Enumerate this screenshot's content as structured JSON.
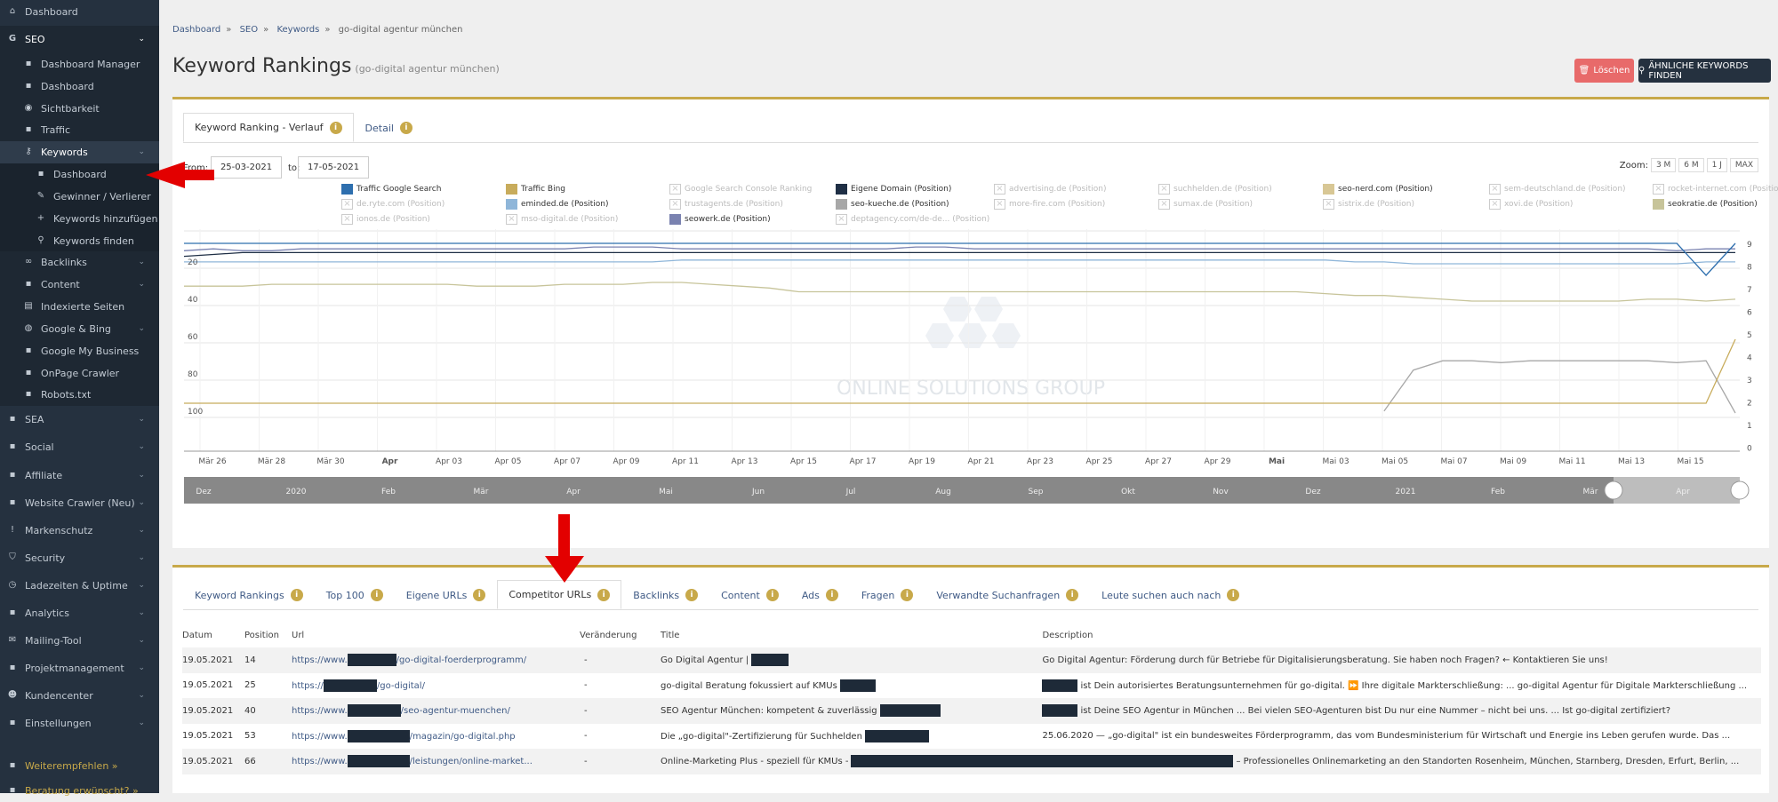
{
  "sidebar": {
    "items": [
      {
        "label": "Dashboard",
        "icon": "home-icon"
      },
      {
        "label": "SEO",
        "icon": "google-g-icon"
      },
      {
        "label": "Dashboard Manager",
        "icon": "dashboard-gauge-icon"
      },
      {
        "label": "Dashboard",
        "icon": "dashboard-gauge-icon"
      },
      {
        "label": "Sichtbarkeit",
        "icon": "eye-icon"
      },
      {
        "label": "Traffic",
        "icon": "traffic-icon"
      },
      {
        "label": "Keywords",
        "icon": "keys-icon"
      },
      {
        "label": "Dashboard",
        "icon": "dashboard-gauge-icon"
      },
      {
        "label": "Gewinner / Verlierer",
        "icon": "edit-icon"
      },
      {
        "label": "Keywords hinzufügen",
        "icon": "plus-icon"
      },
      {
        "label": "Keywords finden",
        "icon": "search-icon"
      },
      {
        "label": "Backlinks",
        "icon": "link-icon"
      },
      {
        "label": "Content",
        "icon": "content-icon"
      },
      {
        "label": "Indexierte Seiten",
        "icon": "file-icon"
      },
      {
        "label": "Google & Bing",
        "icon": "globe-icon"
      },
      {
        "label": "Google My Business",
        "icon": "business-icon"
      },
      {
        "label": "OnPage Crawler",
        "icon": "crawler-icon"
      },
      {
        "label": "Robots.txt",
        "icon": "robot-icon"
      },
      {
        "label": "SEA",
        "icon": "pie-chart-icon"
      },
      {
        "label": "Social",
        "icon": "facebook-icon"
      },
      {
        "label": "Affiliate",
        "icon": "handshake-icon"
      },
      {
        "label": "Website Crawler (Neu)",
        "icon": "area-chart-icon"
      },
      {
        "label": "Markenschutz",
        "icon": "exclamation-icon"
      },
      {
        "label": "Security",
        "icon": "shield-icon"
      },
      {
        "label": "Ladezeiten & Uptime",
        "icon": "clock-icon"
      },
      {
        "label": "Analytics",
        "icon": "analytics-icon"
      },
      {
        "label": "Mailing-Tool",
        "icon": "mail-icon"
      },
      {
        "label": "Projektmanagement",
        "icon": "briefcase-icon"
      },
      {
        "label": "Kundencenter",
        "icon": "users-icon"
      },
      {
        "label": "Einstellungen",
        "icon": "user-settings-icon"
      },
      {
        "label": "Weiterempfehlen »",
        "icon": "handshake-icon"
      },
      {
        "label": "Beratung erwünscht? »",
        "icon": "chat-icon"
      }
    ]
  },
  "breadcrumb": [
    "Dashboard",
    "SEO",
    "Keywords",
    "go-digital agentur münchen"
  ],
  "page": {
    "title": "Keyword Rankings",
    "subtitle": "(go-digital agentur münchen)",
    "delete_label": "Löschen",
    "similar_label": "ÄHNLICHE KEYWORDS FINDEN"
  },
  "top_tabs": [
    "Keyword Ranking - Verlauf",
    "Detail"
  ],
  "info_glyph": "i",
  "range": {
    "from_label": "From:",
    "from": "25-03-2021",
    "to_label": "to:",
    "to": "17-05-2021"
  },
  "zoom": {
    "label": "Zoom:",
    "options": [
      "3 M",
      "6 M",
      "1 J",
      "MAX"
    ]
  },
  "legend": [
    {
      "name": "Traffic Google Search",
      "color": "#2e6fae",
      "on": true
    },
    {
      "name": "Traffic Bing",
      "color": "#c8ac5c",
      "on": true
    },
    {
      "name": "Google Search Console Ranking",
      "on": false
    },
    {
      "name": "Eigene Domain (Position)",
      "color": "#1f2f45",
      "on": true
    },
    {
      "name": "advertising.de (Position)",
      "on": false
    },
    {
      "name": "suchhelden.de (Position)",
      "on": false
    },
    {
      "name": "seo-nerd.com (Position)",
      "color": "#d8c795",
      "on": true
    },
    {
      "name": "sem-deutschland.de (Position)",
      "on": false
    },
    {
      "name": "rocket-internet.com (Position)",
      "on": false
    },
    {
      "name": "de.ryte.com (Position)",
      "on": false
    },
    {
      "name": "eminded.de (Position)",
      "color": "#8fb6d9",
      "on": true
    },
    {
      "name": "trustagents.de (Position)",
      "on": false
    },
    {
      "name": "seo-kueche.de (Position)",
      "color": "#a8a8a8",
      "on": true
    },
    {
      "name": "more-fire.com (Position)",
      "on": false
    },
    {
      "name": "sumax.de (Position)",
      "on": false
    },
    {
      "name": "sistrix.de (Position)",
      "on": false
    },
    {
      "name": "xovi.de (Position)",
      "on": false
    },
    {
      "name": "seokratie.de (Position)",
      "color": "#c7c49a",
      "on": true
    },
    {
      "name": "ionos.de (Position)",
      "on": false
    },
    {
      "name": "mso-digital.de (Position)",
      "on": false
    },
    {
      "name": "seowerk.de (Position)",
      "color": "#7a82b0",
      "on": true
    },
    {
      "name": "deptagency.com/de-de... (Position)",
      "on": false
    }
  ],
  "chart_data": {
    "type": "line",
    "x": [
      "Mär 26",
      "Mär 28",
      "Mär 30",
      "Apr",
      "Apr 03",
      "Apr 05",
      "Apr 07",
      "Apr 09",
      "Apr 11",
      "Apr 13",
      "Apr 15",
      "Apr 17",
      "Apr 19",
      "Apr 21",
      "Apr 23",
      "Apr 25",
      "Apr 27",
      "Apr 29",
      "Mai",
      "Mai 03",
      "Mai 05",
      "Mai 07",
      "Mai 09",
      "Mai 11",
      "Mai 13",
      "Mai 15"
    ],
    "y_left_ticks": [
      "20",
      "40",
      "60",
      "80",
      "100"
    ],
    "y_right_ticks": [
      "9",
      "8",
      "7",
      "6",
      "5",
      "4",
      "3",
      "2",
      "1",
      "0"
    ],
    "navigator_labels": [
      "Dez",
      "2020",
      "Feb",
      "Mär",
      "Apr",
      "Mai",
      "Jun",
      "Jul",
      "Aug",
      "Sep",
      "Okt",
      "Nov",
      "Dez",
      "2021",
      "Feb",
      "Mär",
      "Apr"
    ],
    "watermark": "ONLINE SOLUTIONS GROUP",
    "series": [
      {
        "name": "Eigene Domain (Position)",
        "color": "#1f2f45",
        "values": [
          16,
          15,
          14,
          14,
          14,
          14,
          14,
          14,
          14,
          14,
          14,
          14,
          14,
          14,
          14,
          14,
          14,
          14,
          14,
          14,
          14,
          14,
          14,
          14,
          14,
          14,
          14,
          14,
          14,
          14,
          14,
          14,
          14,
          14,
          14,
          14,
          14,
          14,
          14,
          14,
          14,
          14,
          14,
          14,
          14,
          14,
          14,
          14,
          14,
          14,
          14,
          14,
          14,
          14
        ]
      },
      {
        "name": "seowerk.de (Position)",
        "color": "#7a82b0",
        "values": [
          13,
          12,
          13,
          13,
          12,
          12,
          12,
          12,
          12,
          12,
          12,
          12,
          12,
          12,
          11,
          11,
          11,
          12,
          12,
          12,
          12,
          12,
          12,
          12,
          12,
          11,
          11,
          12,
          12,
          12,
          12,
          12,
          12,
          12,
          12,
          12,
          12,
          12,
          12,
          12,
          12,
          12,
          12,
          12,
          12,
          12,
          12,
          12,
          12,
          12,
          12,
          13,
          12,
          12
        ]
      },
      {
        "name": "eminded.de (Position)",
        "color": "#8fb6d9",
        "values": [
          19,
          19,
          19,
          19,
          19,
          19,
          19,
          19,
          19,
          19,
          19,
          19,
          19,
          19,
          19,
          19,
          19,
          18,
          18,
          18,
          18,
          18,
          18,
          18,
          18,
          18,
          18,
          18,
          18,
          18,
          18,
          18,
          18,
          18,
          18,
          18,
          18,
          18,
          18,
          18,
          19,
          19,
          20,
          20,
          20,
          20,
          20,
          20,
          20,
          20,
          20,
          20,
          19,
          19
        ]
      },
      {
        "name": "seokratie.de (Position)",
        "color": "#c7c49a",
        "values": [
          32,
          32,
          32,
          31,
          31,
          31,
          31,
          31,
          31,
          31,
          32,
          32,
          32,
          31,
          31,
          31,
          30,
          30,
          31,
          32,
          33,
          35,
          35,
          35,
          35,
          35,
          35,
          35,
          35,
          35,
          35,
          35,
          35,
          35,
          35,
          35,
          35,
          35,
          35,
          36,
          37,
          37,
          38,
          39,
          40,
          40,
          40,
          40,
          40,
          40,
          39,
          39,
          40,
          39
        ]
      },
      {
        "name": "seo-kueche.de (Position)",
        "color": "#a8a8a8",
        "values": [
          null,
          null,
          null,
          null,
          null,
          null,
          null,
          null,
          null,
          null,
          null,
          null,
          null,
          null,
          null,
          null,
          null,
          null,
          null,
          null,
          null,
          null,
          null,
          null,
          null,
          null,
          null,
          null,
          null,
          null,
          null,
          null,
          null,
          null,
          null,
          null,
          null,
          null,
          null,
          null,
          null,
          99,
          77,
          72,
          72,
          73,
          72,
          72,
          72,
          72,
          72,
          73,
          72,
          100
        ]
      },
      {
        "name": "Traffic Google Search",
        "color": "#2e6fae",
        "axis": "right",
        "values": [
          9,
          9,
          9,
          9,
          9,
          9,
          9,
          9,
          9,
          9,
          9,
          9,
          9,
          9,
          9,
          9,
          9,
          9,
          9,
          9,
          9,
          9,
          9,
          9,
          9,
          9,
          9,
          9,
          9,
          9,
          9,
          9,
          9,
          9,
          9,
          9,
          9,
          9,
          9,
          9,
          9,
          9,
          9,
          9,
          9,
          9,
          9,
          9,
          9,
          9,
          9,
          9,
          7.5,
          9
        ]
      },
      {
        "name": "Traffic Bing",
        "color": "#c8ac5c",
        "axis": "right",
        "values": [
          1.5,
          1.5,
          1.5,
          1.5,
          1.5,
          1.5,
          1.5,
          1.5,
          1.5,
          1.5,
          1.5,
          1.5,
          1.5,
          1.5,
          1.5,
          1.5,
          1.5,
          1.5,
          1.5,
          1.5,
          1.5,
          1.5,
          1.5,
          1.5,
          1.5,
          1.5,
          1.5,
          1.5,
          1.5,
          1.5,
          1.5,
          1.5,
          1.5,
          1.5,
          1.5,
          1.5,
          1.5,
          1.5,
          1.5,
          1.5,
          1.5,
          1.5,
          1.5,
          1.5,
          1.5,
          1.5,
          1.5,
          1.5,
          1.5,
          1.5,
          1.5,
          1.5,
          1.5,
          4.5
        ]
      }
    ]
  },
  "bottom_tabs": [
    "Keyword Rankings",
    "Top 100",
    "Eigene URLs",
    "Competitor URLs",
    "Backlinks",
    "Content",
    "Ads",
    "Fragen",
    "Verwandte Suchanfragen",
    "Leute suchen auch nach"
  ],
  "table": {
    "headers": [
      "Datum",
      "Position",
      "Url",
      "Veränderung",
      "Title",
      "Description"
    ],
    "rows": [
      {
        "datum": "19.05.2021",
        "position": "14",
        "url_a": "https://www.",
        "url_b": "/go-digital-foerderprogramm/",
        "change": "-",
        "title": "Go Digital Agentur |",
        "desc": "Go Digital Agentur: Förderung durch für Betriebe für Digitalisierungsberatung. Sie haben noch Fragen? ← Kontaktieren Sie uns!"
      },
      {
        "datum": "19.05.2021",
        "position": "25",
        "url_a": "https://",
        "url_b": "/go-digital/",
        "change": "-",
        "title": "go-digital Beratung fokussiert auf KMUs",
        "desc": "ist Dein autorisiertes Beratungsunternehmen für go-digital. ⏩ Ihre digitale Markterschließung: ... go-digital Agentur für Digitale Markterschließung ..."
      },
      {
        "datum": "19.05.2021",
        "position": "40",
        "url_a": "https://www.",
        "url_b": "/seo-agentur-muenchen/",
        "change": "-",
        "title": "SEO Agentur München: kompetent & zuverlässig",
        "desc": "ist Deine SEO Agentur in München ... Bei vielen SEO-Agenturen bist Du nur eine Nummer – nicht bei uns. ... Ist  go-digital zertifiziert?"
      },
      {
        "datum": "19.05.2021",
        "position": "53",
        "url_a": "https://www.",
        "url_b": "/magazin/go-digital.php",
        "change": "-",
        "title": "Die „go-digital\"-Zertifizierung für Suchhelden",
        "desc": "25.06.2020 — „go-digital\" ist ein bundesweites Förderprogramm, das vom Bundesministerium für Wirtschaft und Energie ins Leben gerufen wurde. Das ..."
      },
      {
        "datum": "19.05.2021",
        "position": "66",
        "url_a": "https://www.",
        "url_b": "/leistungen/online-market...",
        "change": "-",
        "title": "Online-Marketing Plus - speziell für KMUs -",
        "desc": "– Professionelles Onlinemarketing an den Standorten Rosenheim, München, Starnberg, Dresden, Erfurt, Berlin, ..."
      }
    ]
  }
}
